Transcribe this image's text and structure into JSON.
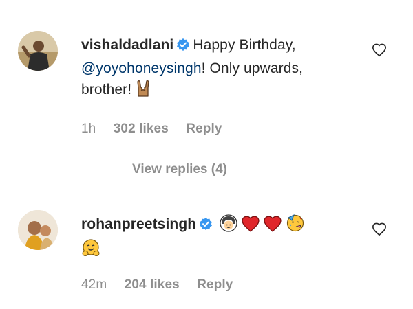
{
  "comments": [
    {
      "username": "vishaldadlani",
      "text_part1": "Happy Birthday,",
      "mention": "@yoyohoneysingh",
      "text_part2": "! Only upwards,",
      "text_part3": "brother!",
      "emoji": "horns-emoji",
      "time": "1h",
      "likes": "302 likes",
      "reply": "Reply"
    },
    {
      "username": "rohanpreetsingh",
      "emojis": [
        "smiling-face-with-headscarf-emoji",
        "red-heart-emoji",
        "red-heart-emoji",
        "partying-face-emoji",
        "hugging-face-emoji"
      ],
      "time": "42m",
      "likes": "204 likes",
      "reply": "Reply"
    }
  ],
  "view_replies": "View replies (4)",
  "colors": {
    "text": "#262626",
    "meta": "#8e8e8e",
    "mention": "#00376b",
    "verified": "#3897f0",
    "heart_emoji": "#e0262b"
  }
}
